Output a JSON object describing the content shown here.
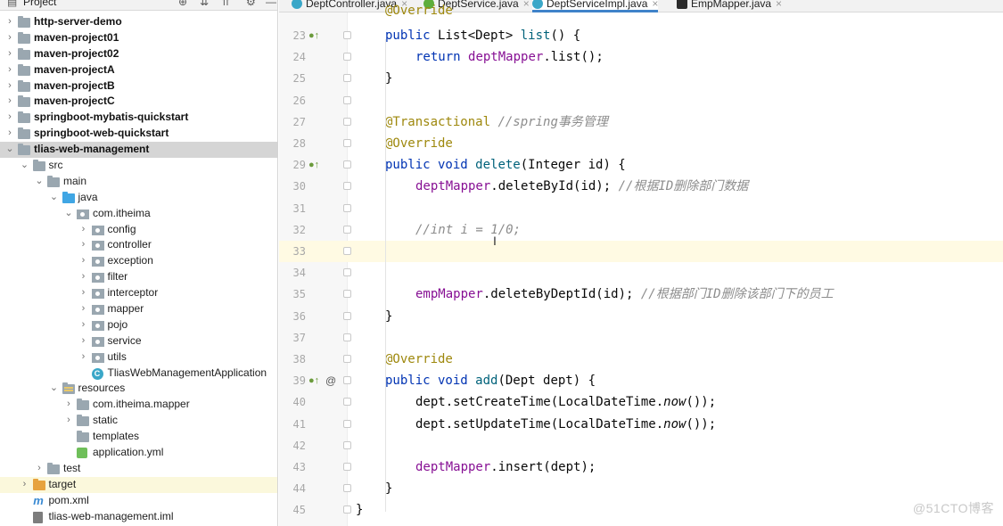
{
  "project_panel": {
    "title": "Project",
    "tree": [
      {
        "label": "http-server-demo",
        "bold": true,
        "indent": 0,
        "chevron": "right",
        "icon": "module-folder-icon"
      },
      {
        "label": "maven-project01",
        "bold": true,
        "indent": 0,
        "chevron": "right",
        "icon": "module-folder-icon"
      },
      {
        "label": "maven-project02",
        "bold": true,
        "indent": 0,
        "chevron": "right",
        "icon": "module-folder-icon"
      },
      {
        "label": "maven-projectA",
        "bold": true,
        "indent": 0,
        "chevron": "right",
        "icon": "module-folder-icon"
      },
      {
        "label": "maven-projectB",
        "bold": true,
        "indent": 0,
        "chevron": "right",
        "icon": "module-folder-icon"
      },
      {
        "label": "maven-projectC",
        "bold": true,
        "indent": 0,
        "chevron": "right",
        "icon": "module-folder-icon"
      },
      {
        "label": "springboot-mybatis-quickstart",
        "bold": true,
        "indent": 0,
        "chevron": "right",
        "icon": "module-folder-icon"
      },
      {
        "label": "springboot-web-quickstart",
        "bold": true,
        "indent": 0,
        "chevron": "right",
        "icon": "module-folder-icon"
      },
      {
        "label": "tlias-web-management",
        "bold": true,
        "indent": 0,
        "chevron": "down",
        "icon": "module-folder-icon",
        "selected": true
      },
      {
        "label": "src",
        "bold": false,
        "indent": 1,
        "chevron": "down",
        "icon": "folder-icon"
      },
      {
        "label": "main",
        "bold": false,
        "indent": 2,
        "chevron": "down",
        "icon": "folder-icon"
      },
      {
        "label": "java",
        "bold": false,
        "indent": 3,
        "chevron": "down",
        "icon": "source-folder-icon"
      },
      {
        "label": "com.itheima",
        "bold": false,
        "indent": 4,
        "chevron": "down",
        "icon": "package-icon"
      },
      {
        "label": "config",
        "bold": false,
        "indent": 5,
        "chevron": "right",
        "icon": "package-icon"
      },
      {
        "label": "controller",
        "bold": false,
        "indent": 5,
        "chevron": "right",
        "icon": "package-icon"
      },
      {
        "label": "exception",
        "bold": false,
        "indent": 5,
        "chevron": "right",
        "icon": "package-icon"
      },
      {
        "label": "filter",
        "bold": false,
        "indent": 5,
        "chevron": "right",
        "icon": "package-icon"
      },
      {
        "label": "interceptor",
        "bold": false,
        "indent": 5,
        "chevron": "right",
        "icon": "package-icon"
      },
      {
        "label": "mapper",
        "bold": false,
        "indent": 5,
        "chevron": "right",
        "icon": "package-icon"
      },
      {
        "label": "pojo",
        "bold": false,
        "indent": 5,
        "chevron": "right",
        "icon": "package-icon"
      },
      {
        "label": "service",
        "bold": false,
        "indent": 5,
        "chevron": "right",
        "icon": "package-icon"
      },
      {
        "label": "utils",
        "bold": false,
        "indent": 5,
        "chevron": "right",
        "icon": "package-icon"
      },
      {
        "label": "TliasWebManagementApplication",
        "bold": false,
        "indent": 5,
        "chevron": "none",
        "icon": "spring-class-icon"
      },
      {
        "label": "resources",
        "bold": false,
        "indent": 3,
        "chevron": "down",
        "icon": "resources-folder-icon"
      },
      {
        "label": "com.itheima.mapper",
        "bold": false,
        "indent": 4,
        "chevron": "right",
        "icon": "folder-icon"
      },
      {
        "label": "static",
        "bold": false,
        "indent": 4,
        "chevron": "right",
        "icon": "folder-icon"
      },
      {
        "label": "templates",
        "bold": false,
        "indent": 4,
        "chevron": "none",
        "icon": "folder-icon"
      },
      {
        "label": "application.yml",
        "bold": false,
        "indent": 4,
        "chevron": "none",
        "icon": "yaml-file-icon"
      },
      {
        "label": "test",
        "bold": false,
        "indent": 2,
        "chevron": "right",
        "icon": "folder-icon"
      },
      {
        "label": "target",
        "bold": false,
        "indent": 1,
        "chevron": "right",
        "icon": "excluded-folder-icon",
        "excluded": true
      },
      {
        "label": "pom.xml",
        "bold": false,
        "indent": 1,
        "chevron": "none",
        "icon": "maven-file-icon"
      },
      {
        "label": "tlias-web-management.iml",
        "bold": false,
        "indent": 1,
        "chevron": "none",
        "icon": "iml-file-icon"
      }
    ]
  },
  "tabs": [
    {
      "label": "DeptController.java",
      "icon": "class-icon"
    },
    {
      "label": "DeptService.java",
      "icon": "interface-icon"
    },
    {
      "label": "DeptServiceImpl.java",
      "icon": "class-icon",
      "active": true
    },
    {
      "label": "EmpMapper.java",
      "icon": "mapper-interface-icon"
    }
  ],
  "tab_close_glyph": "×",
  "editor": {
    "top_partial_text": "@Override",
    "lines": [
      {
        "n": "23",
        "marker": "implements-icon",
        "tokens": [
          [
            "kw",
            "public "
          ],
          [
            "",
            "List<Dept> "
          ],
          [
            "mn",
            "list"
          ],
          [
            "",
            "() {"
          ]
        ]
      },
      {
        "n": "24",
        "tokens": [
          [
            "kw",
            "return "
          ],
          [
            "fld",
            "deptMapper"
          ],
          [
            "",
            ".list();"
          ]
        ],
        "indent": 2
      },
      {
        "n": "25",
        "tokens": [
          [
            "",
            "}"
          ]
        ]
      },
      {
        "n": "26",
        "tokens": []
      },
      {
        "n": "27",
        "tokens": [
          [
            "ann",
            "@Transactional "
          ],
          [
            "cmt",
            "//spring事务管理"
          ]
        ]
      },
      {
        "n": "28",
        "tokens": [
          [
            "ann",
            "@Override"
          ]
        ]
      },
      {
        "n": "29",
        "marker": "implements-icon",
        "tokens": [
          [
            "kw",
            "public void "
          ],
          [
            "mn",
            "delete"
          ],
          [
            "",
            "(Integer id) {"
          ]
        ]
      },
      {
        "n": "30",
        "tokens": [
          [
            "fld",
            "deptMapper"
          ],
          [
            "",
            ".deleteById(id); "
          ],
          [
            "cmt",
            "//根据ID删除部门数据"
          ]
        ],
        "indent": 2
      },
      {
        "n": "31",
        "tokens": []
      },
      {
        "n": "32",
        "tokens": [
          [
            "cmt",
            "//int i = 1/0;"
          ]
        ],
        "indent": 2
      },
      {
        "n": "33",
        "tokens": [],
        "current": true
      },
      {
        "n": "34",
        "tokens": []
      },
      {
        "n": "35",
        "tokens": [
          [
            "fld",
            "empMapper"
          ],
          [
            "",
            ".deleteByDeptId(id); "
          ],
          [
            "cmt",
            "//根据部门ID删除该部门下的员工"
          ]
        ],
        "indent": 2
      },
      {
        "n": "36",
        "tokens": [
          [
            "",
            "}"
          ]
        ]
      },
      {
        "n": "37",
        "tokens": []
      },
      {
        "n": "38",
        "tokens": [
          [
            "ann",
            "@Override"
          ]
        ]
      },
      {
        "n": "39",
        "marker": "implements-icon",
        "at": "@",
        "tokens": [
          [
            "kw",
            "public void "
          ],
          [
            "mn",
            "add"
          ],
          [
            "",
            "(Dept dept) {"
          ]
        ]
      },
      {
        "n": "40",
        "tokens": [
          [
            "",
            "dept.setCreateTime(LocalDateTime."
          ],
          [
            "itl",
            "now"
          ],
          [
            "",
            "());"
          ]
        ],
        "indent": 2
      },
      {
        "n": "41",
        "tokens": [
          [
            "",
            "dept.setUpdateTime(LocalDateTime."
          ],
          [
            "itl",
            "now"
          ],
          [
            "",
            "());"
          ]
        ],
        "indent": 2
      },
      {
        "n": "42",
        "tokens": []
      },
      {
        "n": "43",
        "tokens": [
          [
            "fld",
            "deptMapper"
          ],
          [
            "",
            ".insert(dept);"
          ]
        ],
        "indent": 2
      },
      {
        "n": "44",
        "tokens": [
          [
            "",
            "}"
          ]
        ]
      },
      {
        "n": "45",
        "tokens": [
          [
            "",
            "}"
          ]
        ],
        "indent": 0
      }
    ]
  },
  "watermark": "@51CTO博客",
  "cursor_glyph": "I"
}
